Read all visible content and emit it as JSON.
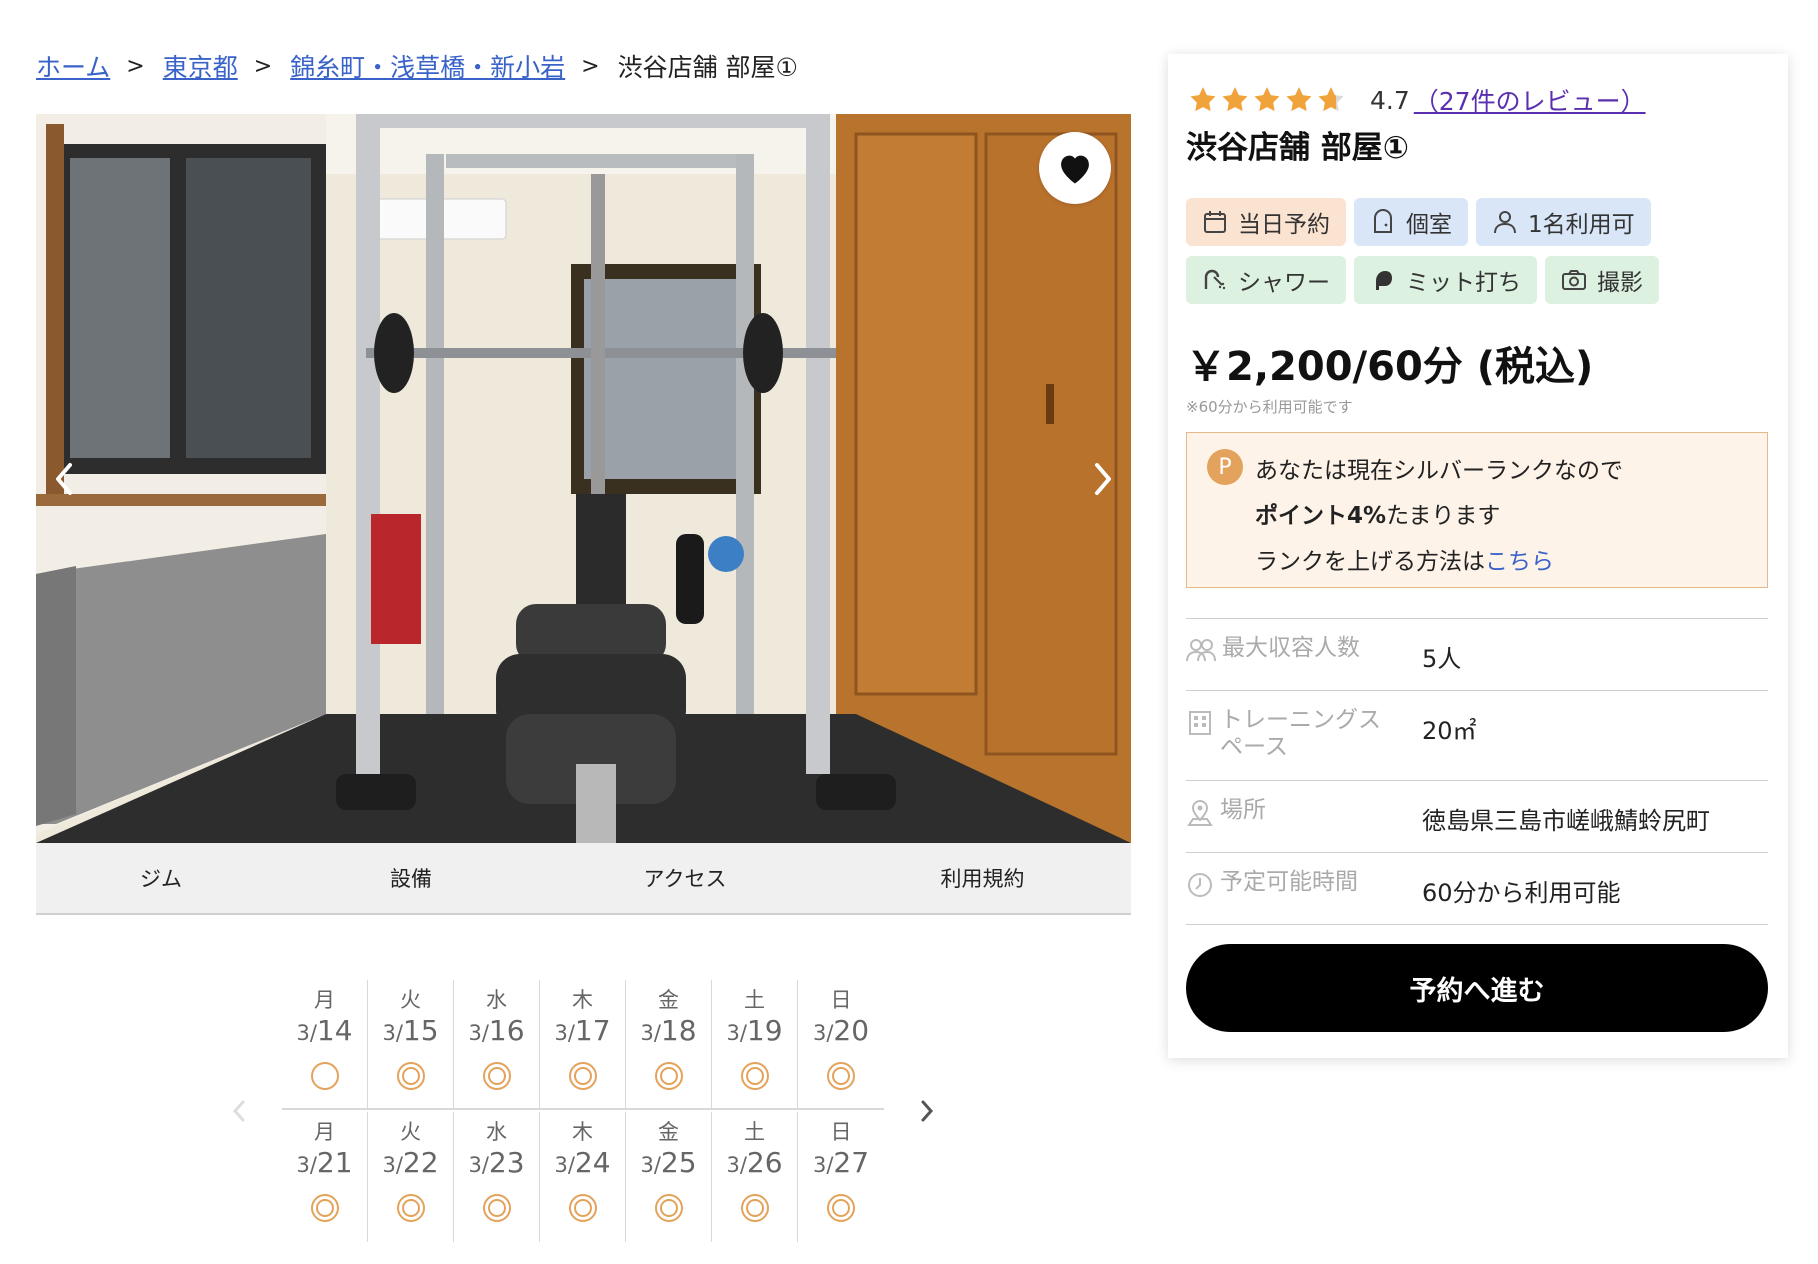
{
  "breadcrumb": {
    "items": [
      {
        "label": "ホーム"
      },
      {
        "label": "東京都"
      },
      {
        "label": "錦糸町・浅草橋・新小岩"
      }
    ],
    "separator": ">",
    "current": "渋谷店舗 部屋①"
  },
  "tabs": [
    "ジム",
    "設備",
    "アクセス",
    "利用規約"
  ],
  "calendar": {
    "weeks": [
      [
        {
          "dow": "月",
          "month": "3/",
          "day": "14",
          "mark": "single"
        },
        {
          "dow": "火",
          "month": "3/",
          "day": "15",
          "mark": "double"
        },
        {
          "dow": "水",
          "month": "3/",
          "day": "16",
          "mark": "double"
        },
        {
          "dow": "木",
          "month": "3/",
          "day": "17",
          "mark": "double"
        },
        {
          "dow": "金",
          "month": "3/",
          "day": "18",
          "mark": "double"
        },
        {
          "dow": "土",
          "month": "3/",
          "day": "19",
          "mark": "double"
        },
        {
          "dow": "日",
          "month": "3/",
          "day": "20",
          "mark": "double"
        }
      ],
      [
        {
          "dow": "月",
          "month": "3/",
          "day": "21",
          "mark": "double"
        },
        {
          "dow": "火",
          "month": "3/",
          "day": "22",
          "mark": "double"
        },
        {
          "dow": "水",
          "month": "3/",
          "day": "23",
          "mark": "double"
        },
        {
          "dow": "木",
          "month": "3/",
          "day": "24",
          "mark": "double"
        },
        {
          "dow": "金",
          "month": "3/",
          "day": "25",
          "mark": "double"
        },
        {
          "dow": "土",
          "month": "3/",
          "day": "26",
          "mark": "double"
        },
        {
          "dow": "日",
          "month": "3/",
          "day": "27",
          "mark": "double"
        }
      ]
    ],
    "mark_color": "#e3a35c"
  },
  "panel": {
    "rating": {
      "value": "4.7",
      "stars": 4.7,
      "review_link": "（27件のレビュー）",
      "star_color": "#f0a33a"
    },
    "title": "渋谷店舗 部屋①",
    "tags": [
      {
        "label": "当日予約",
        "icon": "calendar-icon",
        "style": "orange"
      },
      {
        "label": "個室",
        "icon": "door-icon",
        "style": "blue"
      },
      {
        "label": "1名利用可",
        "icon": "person-icon",
        "style": "blue"
      },
      {
        "label": "シャワー",
        "icon": "shower-icon",
        "style": "green"
      },
      {
        "label": "ミット打ち",
        "icon": "boxing-glove-icon",
        "style": "green"
      },
      {
        "label": "撮影",
        "icon": "camera-icon",
        "style": "green"
      }
    ],
    "price": "￥2,200/60分 (税込)",
    "price_note": "※60分から利用可能です",
    "point": {
      "badge": "P",
      "line1": "あなたは現在シルバーランクなので",
      "line2_bold": "ポイント4%",
      "line2_rest": "たまります",
      "line3_text": "ランクを上げる方法は",
      "line3_link": "こちら"
    },
    "info": [
      {
        "label": "最大収容人数",
        "value": "5人",
        "icon": "people-icon"
      },
      {
        "label": "トレーニングスペース",
        "value": "20㎡",
        "icon": "building-icon"
      },
      {
        "label": "場所",
        "value": "徳島県三島市嵯峨鯖蛉尻町",
        "icon": "location-icon"
      },
      {
        "label": "予定可能時間",
        "value": "60分から利用可能",
        "icon": "clock-icon"
      }
    ],
    "reserve_button": "予約へ進む"
  },
  "colors": {
    "link": "#3a63c9",
    "accent_orange": "#e3a35c",
    "tag_orange": "#fbe3d2",
    "tag_blue": "#d9e6f7",
    "tag_green": "#ddf1e0"
  }
}
